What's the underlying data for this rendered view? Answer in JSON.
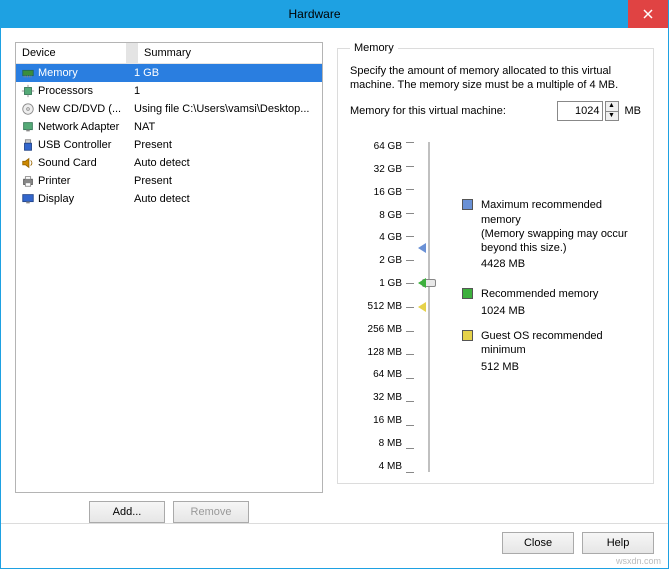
{
  "window": {
    "title": "Hardware"
  },
  "devices": {
    "header": {
      "device": "Device",
      "summary": "Summary"
    },
    "rows": [
      {
        "name": "Memory",
        "summary": "1 GB",
        "icon": "memory"
      },
      {
        "name": "Processors",
        "summary": "1",
        "icon": "cpu"
      },
      {
        "name": "New CD/DVD (...",
        "summary": "Using file C:\\Users\\vamsi\\Desktop...",
        "icon": "cd"
      },
      {
        "name": "Network Adapter",
        "summary": "NAT",
        "icon": "net"
      },
      {
        "name": "USB Controller",
        "summary": "Present",
        "icon": "usb"
      },
      {
        "name": "Sound Card",
        "summary": "Auto detect",
        "icon": "sound"
      },
      {
        "name": "Printer",
        "summary": "Present",
        "icon": "printer"
      },
      {
        "name": "Display",
        "summary": "Auto detect",
        "icon": "display"
      }
    ],
    "selected_index": 0,
    "add_label": "Add...",
    "remove_label": "Remove"
  },
  "memory": {
    "legend": "Memory",
    "description": "Specify the amount of memory allocated to this virtual machine. The memory size must be a multiple of 4 MB.",
    "input_label": "Memory for this virtual machine:",
    "value": "1024",
    "unit": "MB",
    "scale": [
      "64 GB",
      "32 GB",
      "16 GB",
      "8 GB",
      "4 GB",
      "2 GB",
      "1 GB",
      "512 MB",
      "256 MB",
      "128 MB",
      "64 MB",
      "32 MB",
      "16 MB",
      "8 MB",
      "4 MB"
    ],
    "max_rec": {
      "label": "Maximum recommended memory",
      "note": "(Memory swapping may occur beyond this size.)",
      "value": "4428 MB",
      "color": "#6a91d6"
    },
    "rec": {
      "label": "Recommended memory",
      "value": "1024 MB",
      "color": "#3db03d"
    },
    "min": {
      "label": "Guest OS recommended minimum",
      "value": "512 MB",
      "color": "#e6d24a"
    }
  },
  "buttons": {
    "close": "Close",
    "help": "Help"
  },
  "watermark": "wsxdn.com"
}
